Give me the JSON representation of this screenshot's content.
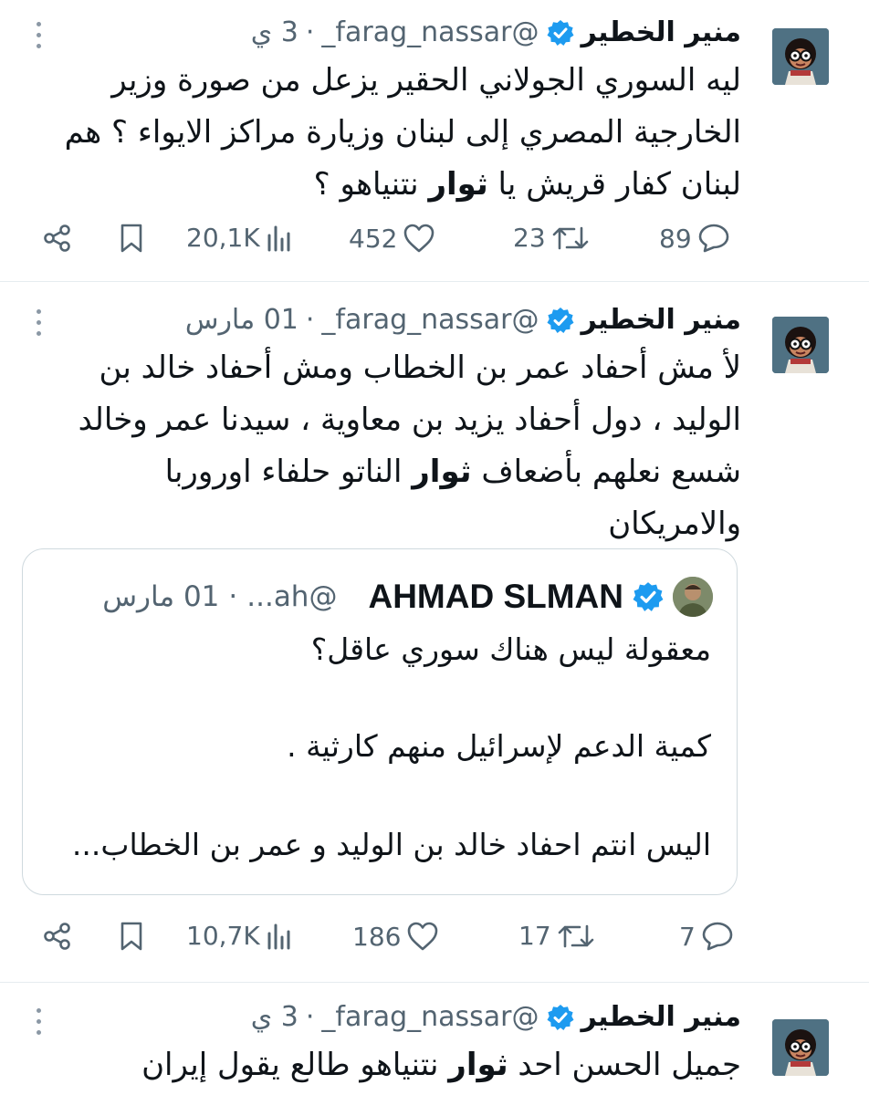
{
  "tweets": [
    {
      "name": "منير الخطير",
      "handle": "@farag_nassar_",
      "dot": "·",
      "time": "3 ي",
      "lines": [
        "ليه السوري الجولاني الحقير يزعل من صورة وزير",
        "الخارجية المصري إلى لبنان وزيارة مراكز الايواء ؟ هم"
      ],
      "line3_before": "لبنان كفار قريش يا ",
      "line3_bold": "ثوار",
      "line3_after": " نتنياهو ؟",
      "replies": "89",
      "retweets": "23",
      "likes": "452",
      "views": "20,1K"
    },
    {
      "name": "منير الخطير",
      "handle": "@farag_nassar_",
      "dot": "·",
      "time": "01 مارس",
      "lines": [
        "لأ مش أحفاد عمر بن الخطاب ومش أحفاد خالد بن",
        "الوليد ، دول أحفاد يزيد بن معاوية ، سيدنا عمر وخالد"
      ],
      "line3_before": "شسع نعلهم بأضعاف ",
      "line3_bold": "ثوار",
      "line3_after": " الناتو حلفاء اوروربا",
      "line4": "والامريكان",
      "quote": {
        "name": "AHMAD SLMAN",
        "handle": "@ah...",
        "dot": "·",
        "time": "01 مارس",
        "line1": "معقولة ليس هناك سوري عاقل؟",
        "line2": "كمية الدعم لإسرائيل منهم كارثية .",
        "line3": "اليس انتم احفاد خالد بن الوليد و عمر بن الخطاب..."
      },
      "replies": "7",
      "retweets": "17",
      "likes": "186",
      "views": "10,7K"
    },
    {
      "name": "منير الخطير",
      "handle": "@farag_nassar_",
      "dot": "·",
      "time": "3 ي",
      "line_before": "جميل الحسن احد ",
      "line_bold": "ثوار",
      "line_after": " نتنياهو طالع يقول إيران"
    }
  ],
  "colors": {
    "verified": "#1d9bf0",
    "secondary": "#536471",
    "text": "#0f1419",
    "border": "#e6ecf0"
  },
  "icons": [
    "share-icon",
    "bookmark-icon",
    "views-icon",
    "like-icon",
    "retweet-icon",
    "reply-icon",
    "more-icon",
    "verified-icon"
  ]
}
